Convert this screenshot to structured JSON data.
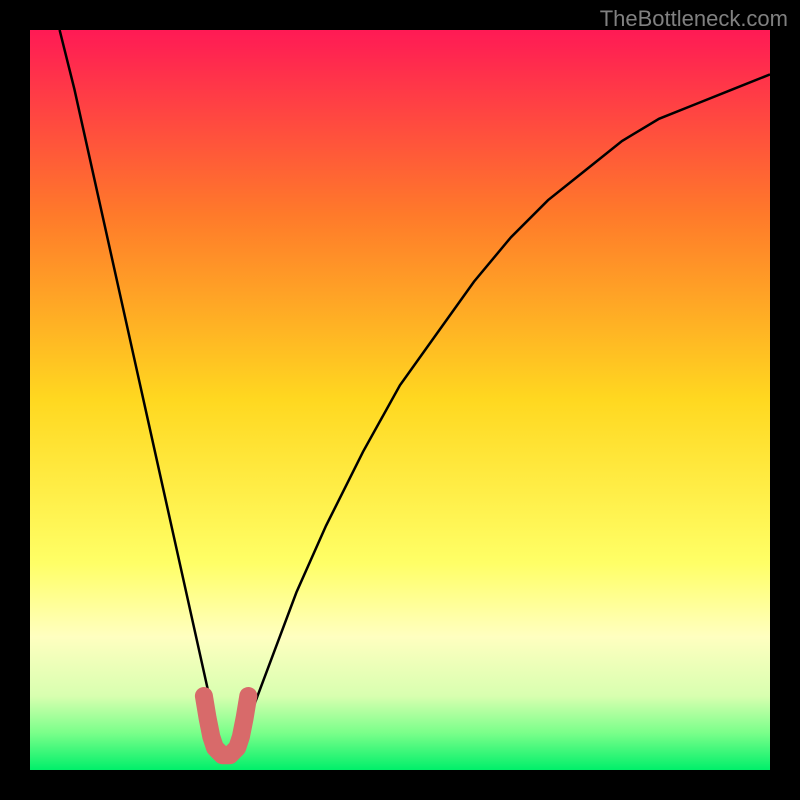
{
  "watermark": "TheBottleneck.com",
  "chart_data": {
    "type": "line",
    "title": "",
    "xlabel": "",
    "ylabel": "",
    "xlim": [
      0,
      100
    ],
    "ylim": [
      0,
      100
    ],
    "gradient_stops": [
      {
        "offset": 0,
        "color": "#ff1a55"
      },
      {
        "offset": 25,
        "color": "#ff7a2a"
      },
      {
        "offset": 50,
        "color": "#ffd820"
      },
      {
        "offset": 72,
        "color": "#ffff66"
      },
      {
        "offset": 82,
        "color": "#ffffc0"
      },
      {
        "offset": 90,
        "color": "#d8ffb0"
      },
      {
        "offset": 95,
        "color": "#7aff8a"
      },
      {
        "offset": 100,
        "color": "#00ef6a"
      }
    ],
    "series": [
      {
        "name": "bottleneck-curve",
        "stroke": "#000000",
        "x": [
          4,
          6,
          8,
          10,
          12,
          14,
          16,
          18,
          20,
          22,
          24,
          25,
          26,
          27,
          28,
          30,
          33,
          36,
          40,
          45,
          50,
          55,
          60,
          65,
          70,
          75,
          80,
          85,
          90,
          95,
          100
        ],
        "values": [
          100,
          92,
          83,
          74,
          65,
          56,
          47,
          38,
          29,
          20,
          11,
          6,
          3,
          2,
          3,
          8,
          16,
          24,
          33,
          43,
          52,
          59,
          66,
          72,
          77,
          81,
          85,
          88,
          90,
          92,
          94
        ]
      }
    ],
    "highlight": {
      "name": "minimum-marker",
      "stroke": "#d86a6a",
      "x": [
        23.5,
        24,
        24.5,
        25,
        26,
        27,
        28,
        28.5,
        29,
        29.5
      ],
      "values": [
        10,
        7,
        4.5,
        3,
        2,
        2,
        3,
        4.5,
        7,
        10
      ]
    }
  }
}
